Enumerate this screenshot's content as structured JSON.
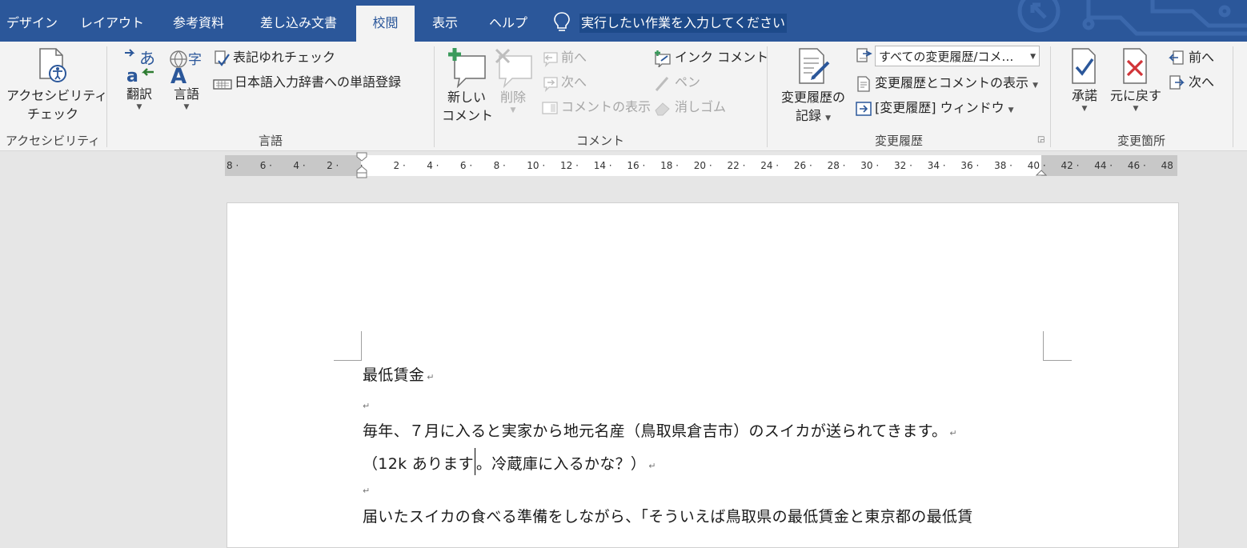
{
  "tabs": [
    {
      "label": "デザイン"
    },
    {
      "label": "レイアウト"
    },
    {
      "label": "参考資料"
    },
    {
      "label": "差し込み文書"
    },
    {
      "label": "校閲",
      "active": true
    },
    {
      "label": "表示"
    },
    {
      "label": "ヘルプ"
    }
  ],
  "tellme": {
    "text": "実行したい作業を入力してください"
  },
  "groups": {
    "accessibility": {
      "label": "アクセシビリティ",
      "check_line1": "アクセシビリティ",
      "check_line2": "チェック"
    },
    "language": {
      "label": "言語",
      "translate": "翻訳",
      "language": "言語",
      "spell_check": "表記ゆれチェック",
      "ime_register": "日本語入力辞書への単語登録"
    },
    "comments": {
      "label": "コメント",
      "new_line1": "新しい",
      "new_line2": "コメント",
      "delete": "削除",
      "prev": "前へ",
      "next": "次へ",
      "show": "コメントの表示",
      "ink": "インク コメント",
      "pen": "ペン",
      "eraser": "消しゴム"
    },
    "tracking": {
      "label": "変更履歴",
      "track_line1": "変更履歴の",
      "track_line2": "記録",
      "select_value": "すべての変更履歴/コメ…",
      "show_markup": "変更履歴とコメントの表示",
      "pane": "[変更履歴] ウィンドウ"
    },
    "changes": {
      "label": "変更箇所",
      "accept": "承諾",
      "reject": "元に戻す",
      "prev": "前へ",
      "next": "次へ"
    }
  },
  "ruler": {
    "ticks": [
      "8",
      "6",
      "4",
      "2",
      "",
      "2",
      "4",
      "6",
      "8",
      "10",
      "12",
      "14",
      "16",
      "18",
      "20",
      "22",
      "24",
      "26",
      "28",
      "30",
      "32",
      "34",
      "36",
      "38",
      "40",
      "42",
      "44",
      "46",
      "48"
    ]
  },
  "document": {
    "title": "最低賃金",
    "p1": "毎年、７月に入ると実家から地元名産（鳥取県倉吉市）のスイカが送られてきます。",
    "p2a": "（12k あります",
    "p2b": "。冷蔵庫に入るかな？）",
    "p3": "届いたスイカの食べる準備をしながら、「そういえば鳥取県の最低賃金と東京都の最低賃",
    "para_mark": "↵"
  },
  "colors": {
    "accent": "#2b579a",
    "ribbon": "#f3f3f3",
    "workspace": "#e6e6e6"
  }
}
